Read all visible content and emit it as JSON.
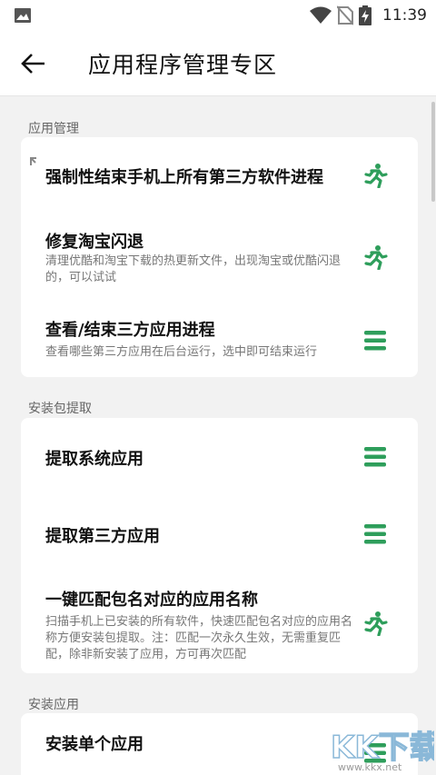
{
  "status_bar": {
    "time": "11:39",
    "icons": [
      "gallery-icon",
      "wifi-icon",
      "no-sim-icon",
      "battery-charging-icon"
    ]
  },
  "app_bar": {
    "title": "应用程序管理专区",
    "back_icon": "arrow-left-icon"
  },
  "colors": {
    "accent": "#2e9e5b",
    "background": "#f2f2f2",
    "card": "#ffffff"
  },
  "sections": [
    {
      "label": "应用管理",
      "items": [
        {
          "title": "强制性结束手机上所有第三方软件进程",
          "desc": "",
          "icon": "runner-icon"
        },
        {
          "title": "修复淘宝闪退",
          "desc": "清理优酷和淘宝下载的热更新文件，出现淘宝或优酷闪退的，可以试试",
          "icon": "runner-icon"
        },
        {
          "title": "查看/结束三方应用进程",
          "desc": "查看哪些第三方应用在后台运行，选中即可结束运行",
          "icon": "menu-icon"
        }
      ]
    },
    {
      "label": "安装包提取",
      "items": [
        {
          "title": "提取系统应用",
          "desc": "",
          "icon": "menu-icon"
        },
        {
          "title": "提取第三方应用",
          "desc": "",
          "icon": "menu-icon"
        },
        {
          "title": "一键匹配包名对应的应用名称",
          "desc": "扫描手机上已安装的所有软件，快速匹配包名对应的应用名称方便安装包提取。注：匹配一次永久生效，无需重复匹配，除非新安装了应用，方可再次匹配",
          "icon": "runner-icon"
        }
      ]
    },
    {
      "label": "安装应用",
      "items": [
        {
          "title": "安装单个应用",
          "desc": "",
          "icon": "menu-icon"
        }
      ]
    }
  ],
  "watermark": {
    "text": "KK下载",
    "url": "www.kkx.net"
  }
}
